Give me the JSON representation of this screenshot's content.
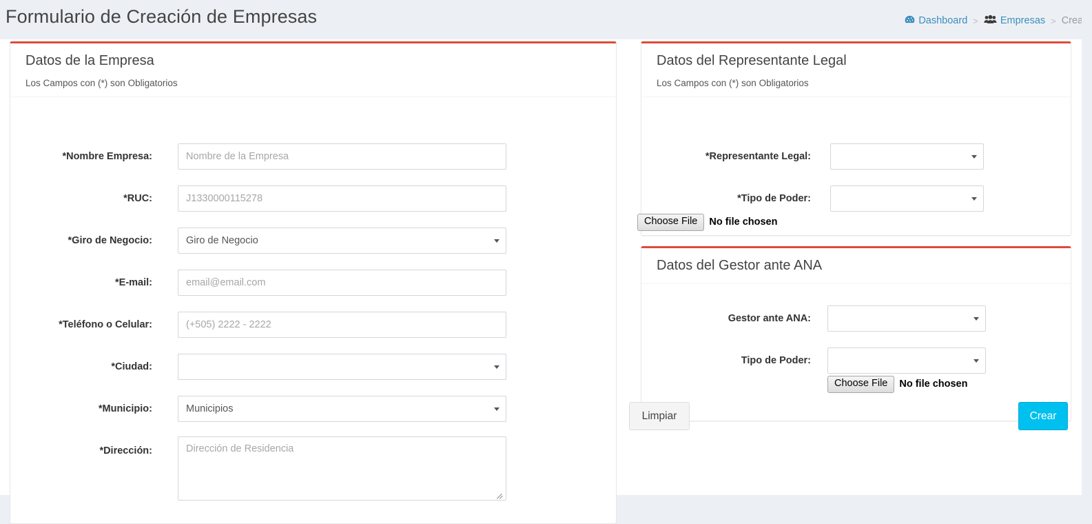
{
  "header": {
    "title": "Formulario de Creación de Empresas",
    "breadcrumb": {
      "dashboard": "Dashboard",
      "dashboard_icon": "dashboard-icon",
      "empresas": "Empresas",
      "empresas_icon": "users-group-icon",
      "current": "Crear",
      "separator": ">"
    }
  },
  "colors": {
    "accent_bar": "#dd4b39",
    "primary_button": "#00c0ef",
    "page_background": "#ecf0f5",
    "breadcrumb_link": "#3c8dbc"
  },
  "empresa_box": {
    "title": "Datos de la Empresa",
    "subtitle": "Los Campos con (*) son Obligatorios",
    "fields": [
      {
        "label": "*Nombre Empresa:",
        "type": "text",
        "placeholder": "Nombre de la Empresa",
        "value": ""
      },
      {
        "label": "*RUC:",
        "type": "text",
        "placeholder": "J1330000115278",
        "value": ""
      },
      {
        "label": "*Giro de Negocio:",
        "type": "select",
        "selected": "Giro de Negocio"
      },
      {
        "label": "*E-mail:",
        "type": "text",
        "placeholder": "email@email.com",
        "value": ""
      },
      {
        "label": "*Teléfono o Celular:",
        "type": "text",
        "placeholder": "(+505) 2222 - 2222",
        "value": ""
      },
      {
        "label": "*Ciudad:",
        "type": "select",
        "selected": ""
      },
      {
        "label": "*Municipio:",
        "type": "select",
        "selected": "Municipios"
      },
      {
        "label": "*Dirección:",
        "type": "textarea",
        "placeholder": "Dirección de Residencia",
        "value": ""
      }
    ]
  },
  "representante_box": {
    "title": "Datos del Representante Legal",
    "subtitle": "Los Campos con (*) son Obligatorios",
    "fields": [
      {
        "label": "*Representante Legal:",
        "type": "select",
        "selected": ""
      },
      {
        "label": "*Tipo de Poder:",
        "type": "select",
        "selected": ""
      }
    ],
    "file": {
      "button_label": "Choose File",
      "status": "No file chosen"
    }
  },
  "gestor_box": {
    "title": "Datos del Gestor ante ANA",
    "fields": [
      {
        "label": "Gestor ante ANA:",
        "type": "select",
        "selected": ""
      },
      {
        "label": "Tipo de Poder:",
        "type": "select",
        "selected": ""
      }
    ],
    "file": {
      "button_label": "Choose File",
      "status": "No file chosen"
    }
  },
  "actions": {
    "clear_label": "Limpiar",
    "submit_label": "Crear"
  }
}
